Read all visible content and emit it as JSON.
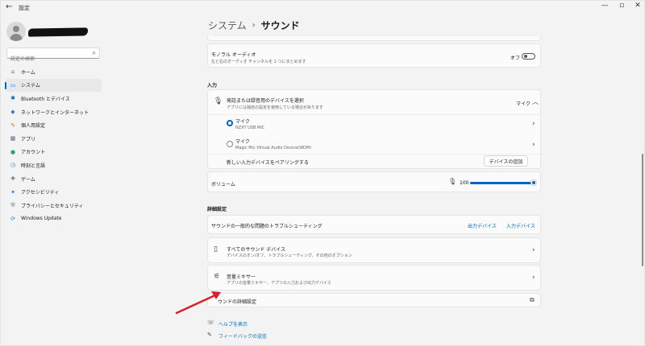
{
  "window": {
    "title": "設定",
    "back": "←",
    "minimize": "—",
    "maximize": "▫",
    "close": "✕"
  },
  "sidebar": {
    "search_placeholder": "設定の検索",
    "items": [
      {
        "label": "ホーム",
        "icon": "home-icon",
        "glyph": "⌂",
        "color": "#666666"
      },
      {
        "label": "システム",
        "icon": "system-icon",
        "glyph": "▭",
        "color": "#0078d4"
      },
      {
        "label": "Bluetooth とデバイス",
        "icon": "bluetooth-icon",
        "glyph": "✱",
        "color": "#0067c0"
      },
      {
        "label": "ネットワークとインターネット",
        "icon": "network-icon",
        "glyph": "◆",
        "color": "#3a78c3"
      },
      {
        "label": "個人用設定",
        "icon": "personalization-icon",
        "glyph": "✎",
        "color": "#c07830"
      },
      {
        "label": "アプリ",
        "icon": "apps-icon",
        "glyph": "▦",
        "color": "#5a6e87"
      },
      {
        "label": "アカウント",
        "icon": "accounts-icon",
        "glyph": "●",
        "color": "#2aa37a"
      },
      {
        "label": "時刻と言語",
        "icon": "time-language-icon",
        "glyph": "◷",
        "color": "#2e88d0"
      },
      {
        "label": "ゲーム",
        "icon": "gaming-icon",
        "glyph": "✚",
        "color": "#6f7b86"
      },
      {
        "label": "アクセシビリティ",
        "icon": "accessibility-icon",
        "glyph": "✦",
        "color": "#1f6fd0"
      },
      {
        "label": "プライバシーとセキュリティ",
        "icon": "privacy-icon",
        "glyph": "⛨",
        "color": "#6c7480"
      },
      {
        "label": "Windows Update",
        "icon": "windows-update-icon",
        "glyph": "⟳",
        "color": "#1d7fd6"
      }
    ],
    "active_index": 1
  },
  "breadcrumb": {
    "parent": "システム",
    "separator": "›",
    "current": "サウンド"
  },
  "mono": {
    "title": "モノラル オーディオ",
    "desc": "左と右のオーディオ チャンネルを 1 つにまとめます",
    "state": "オフ"
  },
  "input": {
    "section_title": "入力",
    "chooser": {
      "title": "発話または録音用のデバイスを選択",
      "desc": "アプリには独自の設定を使用している場合があります",
      "current": "マイク"
    },
    "devices": [
      {
        "name": "マイク",
        "model": "NZXT USB MIC",
        "selected": true
      },
      {
        "name": "マイク",
        "model": "Magic Mic Virtual Audio Device(WDM)",
        "selected": false
      }
    ],
    "pair": {
      "label": "新しい入力デバイスをペアリングする",
      "button": "デバイスの追加"
    },
    "volume": {
      "label": "ボリューム",
      "value": "100",
      "level": 1.0
    }
  },
  "advanced": {
    "section_title": "詳細設定",
    "troubleshoot": {
      "label": "サウンドの一般的な問題のトラブルシューティング",
      "output": "出力デバイス",
      "input": "入力デバイス"
    },
    "all_devices": {
      "title": "すべてのサウンド デバイス",
      "desc": "デバイスのオン/オフ、トラブルシューティング、その他のオプション"
    },
    "mixer": {
      "title": "音量ミキサー",
      "desc": "アプリの音量ミキサー、アプリの入力および出力デバイス"
    },
    "more": {
      "label": "ウンドの詳細設定"
    }
  },
  "footer": {
    "help": "ヘルプを表示",
    "feedback": "フィードバックの送信"
  },
  "annotation": {
    "arrow_color": "#d8202a"
  }
}
